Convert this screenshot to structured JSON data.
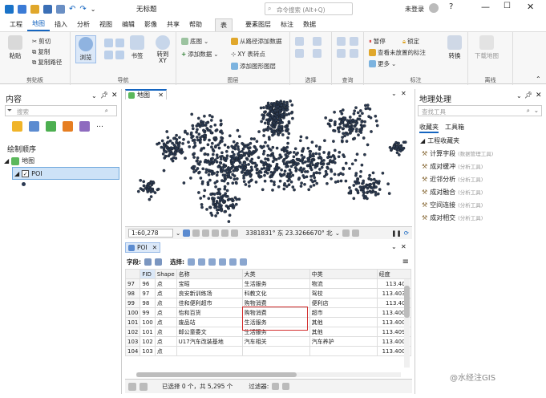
{
  "window": {
    "title": "无标题",
    "search_placeholder": "命令搜索 (Alt+Q)",
    "login": "未登录"
  },
  "menus": [
    "工程",
    "地图",
    "插入",
    "分析",
    "视图",
    "编辑",
    "影像",
    "共享",
    "帮助"
  ],
  "ctx_menus": [
    "表",
    "要素图层",
    "标注",
    "数据"
  ],
  "ribbon": {
    "clipboard": {
      "paste": "粘贴",
      "cut": "剪切",
      "copy": "复制",
      "copy_path": "复制路径",
      "label": "剪贴板"
    },
    "nav": {
      "explore": "浏览",
      "bookmark": "书签",
      "goto": "转到 XY",
      "label": "导航"
    },
    "layer": {
      "basemap": "底图",
      "add_data": "添加数据",
      "from_path": "从路径添加数据",
      "xy_points": "XY 表转点",
      "add_graphics": "添加图形图层",
      "label": "图层"
    },
    "select": {
      "label": "选择"
    },
    "query": {
      "label": "查询"
    },
    "labeling": {
      "pause": "暂停",
      "lock": "锁定",
      "view_unplaced": "查看未放置的标注",
      "more": "更多",
      "convert": "转换",
      "label": "标注"
    },
    "offline": {
      "download": "下载地图",
      "label": "离线"
    }
  },
  "contents": {
    "title": "内容",
    "search_placeholder": "搜索",
    "drawing_order": "绘制顺序",
    "map": "地图",
    "layer": "POI"
  },
  "map_tab": "地图",
  "map_status": {
    "scale": "1:60,278",
    "coords": "3381831° 东 23.3266670° 北"
  },
  "table_tab": "POI",
  "table_toolbar": {
    "fields": "字段:",
    "selection": "选择:"
  },
  "table": {
    "headers": [
      "",
      "FID",
      "Shape",
      "名称",
      "大类",
      "中类",
      "经度"
    ],
    "rows": [
      [
        "97",
        "96",
        "点",
        "宝昭",
        "生活服务",
        "物流",
        "113.405"
      ],
      [
        "98",
        "97",
        "点",
        "良安新训练场",
        "科教文化",
        "驾校",
        "113.4038"
      ],
      [
        "99",
        "98",
        "点",
        "佳和便利超市",
        "购物消费",
        "便利店",
        "113.401"
      ],
      [
        "100",
        "99",
        "点",
        "怡和百货",
        "购物消费",
        "超市",
        "113.4006"
      ],
      [
        "101",
        "100",
        "点",
        "废品站",
        "生活服务",
        "其他",
        "113.4000"
      ],
      [
        "102",
        "101",
        "点",
        "邮公童委文",
        "生活服务",
        "其他",
        "113.4097"
      ],
      [
        "103",
        "102",
        "点",
        "U17汽车改装基地",
        "汽车相关",
        "汽车养护",
        "113.4000"
      ],
      [
        "104",
        "103",
        "点",
        "",
        "",
        "",
        "113.4000"
      ]
    ]
  },
  "table_status": {
    "selection": "已选择 0 个，共 5,295 个",
    "filters": "过滤器:"
  },
  "geoprocessing": {
    "title": "地理处理",
    "search_placeholder": "查找工具",
    "tabs": [
      "收藏夹",
      "工具箱"
    ],
    "folder": "工程收藏夹",
    "tools": [
      {
        "name": "计算字段",
        "hint": "(数据管理工具)"
      },
      {
        "name": "成对缓冲",
        "hint": "(分析工具)"
      },
      {
        "name": "近邻分析",
        "hint": "(分析工具)"
      },
      {
        "name": "成对融合",
        "hint": "(分析工具)"
      },
      {
        "name": "空间连接",
        "hint": "(分析工具)"
      },
      {
        "name": "成对相交",
        "hint": "(分析工具)"
      }
    ]
  },
  "watermark": "@水经注GIS",
  "colors": {
    "accent": "#1565c0",
    "point": "#2b3a52",
    "highlight": "#d32f2f"
  }
}
